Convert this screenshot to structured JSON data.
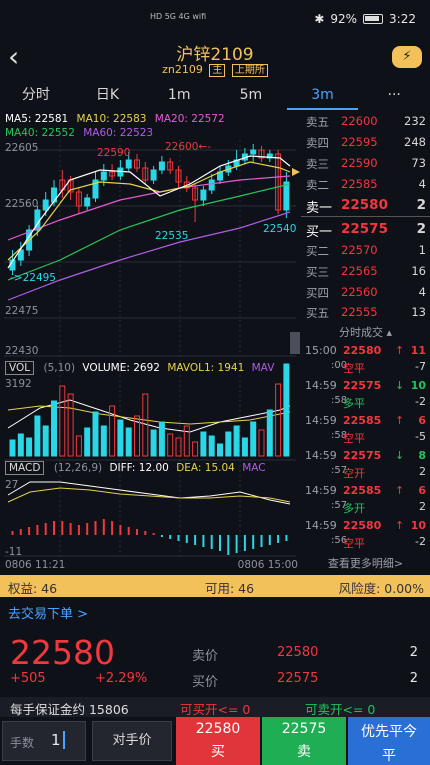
{
  "status": {
    "icons": "HD 5G 4G wifi",
    "bluetooth": "✱",
    "battery": "92%",
    "time": "3:22"
  },
  "header": {
    "back": "‹",
    "title": "沪锌2109",
    "code": "zn2109",
    "tag_main": "主",
    "tag_exchange": "上期所",
    "flash_icon": "⚡"
  },
  "tabs": [
    {
      "label": "分时"
    },
    {
      "label": "日K"
    },
    {
      "label": "1m"
    },
    {
      "label": "5m"
    },
    {
      "label": "3m",
      "active": true
    },
    {
      "label": "···"
    }
  ],
  "ma_legend": {
    "ma5": "MA5: 22581",
    "ma10": "MA10: 22583",
    "ma20": "MA20: 22572",
    "ma40": "MA40: 22552",
    "ma60": "MA60: 22523"
  },
  "price_axis": [
    "22605",
    "22560",
    "22475",
    "22430"
  ],
  "annotations": {
    "high": "22600←-",
    "a1": "22590",
    "a2": "22535",
    "a3": "22540",
    "low": "->22495"
  },
  "volume_legend": {
    "vol": "VOL",
    "params": "(5,10)",
    "volume": "VOLUME: 2692",
    "mavol1": "MAVOL1: 1941",
    "mav": "MAV"
  },
  "volume_axis": "3192",
  "macd_legend": {
    "name": "MACD",
    "params": "(12,26,9)",
    "diff": "DIFF: 12.00",
    "dea": "DEA: 15.04",
    "mac": "MAC"
  },
  "macd_axis": [
    "27",
    "-11"
  ],
  "time_axis": {
    "start": "0806 11:21",
    "end": "0806 15:00"
  },
  "order_book": {
    "asks": [
      {
        "label": "卖五",
        "price": "22600",
        "qty": "232"
      },
      {
        "label": "卖四",
        "price": "22595",
        "qty": "248"
      },
      {
        "label": "卖三",
        "price": "22590",
        "qty": "73"
      },
      {
        "label": "卖二",
        "price": "22585",
        "qty": "4"
      },
      {
        "label": "卖一",
        "price": "22580",
        "qty": "2"
      }
    ],
    "bids": [
      {
        "label": "买一",
        "price": "22575",
        "qty": "2"
      },
      {
        "label": "买二",
        "price": "22570",
        "qty": "1"
      },
      {
        "label": "买三",
        "price": "22565",
        "qty": "16"
      },
      {
        "label": "买四",
        "price": "22560",
        "qty": "4"
      },
      {
        "label": "买五",
        "price": "22555",
        "qty": "13"
      }
    ]
  },
  "trades_header": "分时成交 ▴",
  "trades": [
    {
      "time": "15:00",
      "sec": ":00",
      "price": "22580",
      "type": "空平",
      "arrow": "↑",
      "vol": "11",
      "chg": "-7"
    },
    {
      "time": "14:59",
      "sec": ":58",
      "price": "22575",
      "type": "多平",
      "arrow": "↓",
      "vol": "10",
      "chg": "-2"
    },
    {
      "time": "14:59",
      "sec": ":58",
      "price": "22585",
      "type": "空平",
      "arrow": "↑",
      "vol": "6",
      "chg": "-5"
    },
    {
      "time": "14:59",
      "sec": ":57",
      "price": "22575",
      "type": "空开",
      "arrow": "↓",
      "vol": "8",
      "chg": "2"
    },
    {
      "time": "14:59",
      "sec": ":57",
      "price": "22585",
      "type": "多开",
      "arrow": "↑",
      "vol": "6",
      "chg": "2"
    },
    {
      "time": "14:59",
      "sec": ":56",
      "price": "22580",
      "type": "空平",
      "arrow": "↑",
      "vol": "10",
      "chg": "-2"
    }
  ],
  "more_detail": "查看更多明细>",
  "account": {
    "equity": "权益: 46",
    "available": "可用: 46",
    "risk": "风险度: 0.00%"
  },
  "trade": {
    "go": "去交易下单 >",
    "last": "22580",
    "change": "+505",
    "pct": "+2.29%",
    "ask_label": "卖价",
    "ask_price": "22580",
    "ask_qty": "2",
    "bid_label": "买价",
    "bid_price": "22575",
    "bid_qty": "2",
    "margin": "每手保证金约 15806",
    "buy_open": "可买开<= 0",
    "sell_open": "可卖开<= 0"
  },
  "controls": {
    "qty_label": "手数",
    "qty_value": "1",
    "opp_price": "对手价",
    "buy_price": "22580",
    "buy_label": "买",
    "sell_price": "22575",
    "sell_label": "卖",
    "close_label": "优先平今",
    "close_sub": "平"
  },
  "colors": {
    "up": "#f0383d",
    "down": "#22c35e",
    "accent": "#4aa3ff",
    "gold": "#f3c15a"
  }
}
